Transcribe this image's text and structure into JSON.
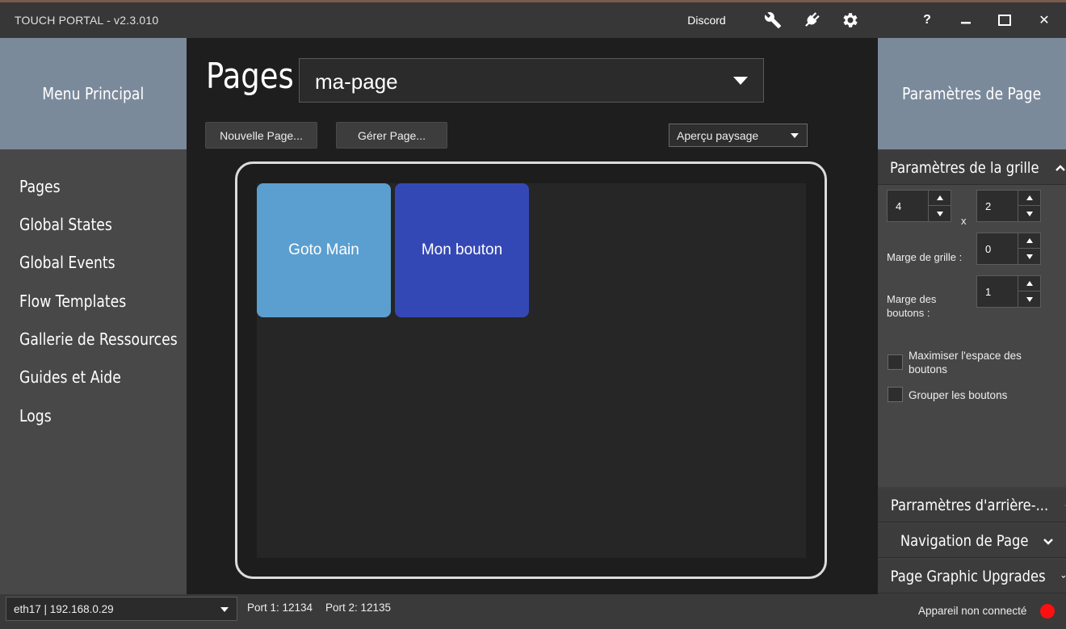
{
  "titlebar": {
    "title": "TOUCH PORTAL - v2.3.010",
    "discord_label": "Discord",
    "icons": [
      "wrench-icon",
      "plug-icon",
      "gear-icon",
      "help-icon",
      "minimize-icon",
      "maximize-icon",
      "close-icon"
    ],
    "help_glyph": "?",
    "close_glyph": "✕"
  },
  "left": {
    "header": "Menu Principal",
    "items": [
      "Pages",
      "Global States",
      "Global Events",
      "Flow Templates",
      "Gallerie de Ressources",
      "Guides et Aide",
      "Logs"
    ]
  },
  "center": {
    "title": "Pages",
    "page_select": "ma-page",
    "new_page_button": "Nouvelle Page...",
    "manage_page_button": "Gérer Page...",
    "preview_select": "Aperçu paysage",
    "buttons": [
      {
        "label": "Goto Main",
        "color": "#5b9fd0"
      },
      {
        "label": "Mon bouton",
        "color": "#3448b5"
      }
    ]
  },
  "right": {
    "header": "Paramètres de Page",
    "grid_section": "Paramètres de la grille",
    "cols": "4",
    "x_sep": "x",
    "rows": "2",
    "grid_margin_label": "Marge de grille :",
    "grid_margin": "0",
    "button_margin_label": "Marge des boutons :",
    "button_margin": "1",
    "maximize_label": "Maximiser l'espace des boutons",
    "maximize_checked": false,
    "group_label": "Grouper les boutons",
    "group_checked": false,
    "background_section": "Parramètres d'arrière-...",
    "navigation_section": "Navigation de Page",
    "graphic_section": "Page Graphic Upgrades"
  },
  "status": {
    "network": "eth17 | 192.168.0.29",
    "port1": "Port 1: 12134",
    "port2": "Port 2: 12135",
    "connection": "Appareil non connecté",
    "connection_color": "#ff1010"
  }
}
